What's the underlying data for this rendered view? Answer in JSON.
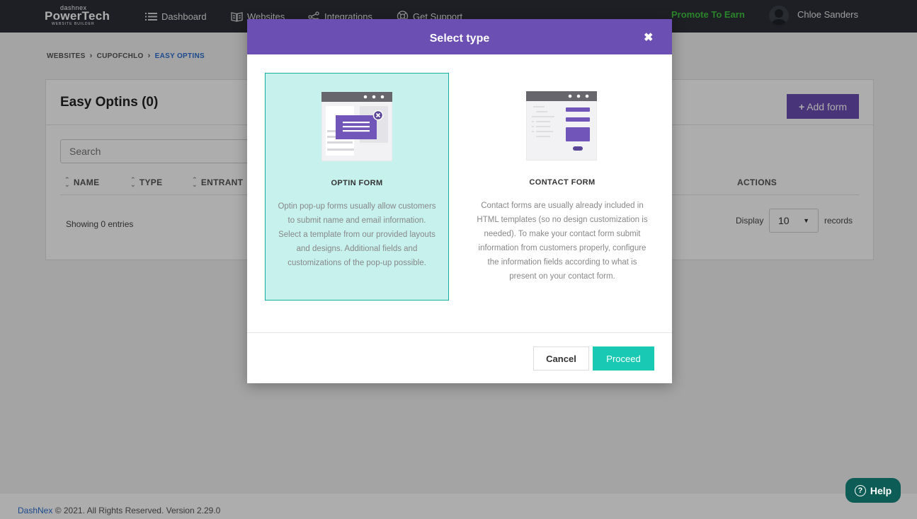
{
  "topbar": {
    "logo": {
      "line1": "dashnex",
      "line2": "PowerTech",
      "line3": "WEBSITE BUILDER"
    },
    "nav": [
      {
        "label": "Dashboard",
        "icon": "list-icon"
      },
      {
        "label": "Websites",
        "icon": "book-icon"
      },
      {
        "label": "Integrations",
        "icon": "share-icon"
      },
      {
        "label": "Get Support",
        "icon": "lifebuoy-icon"
      }
    ],
    "promote_label": "Promote To Earn",
    "user_name": "Chloe Sanders"
  },
  "breadcrumb": [
    "WEBSITES",
    "CUPOFCHLO",
    "EASY OPTINS"
  ],
  "card": {
    "title": "Easy Optins (0)",
    "add_label": "Add form",
    "search_placeholder": "Search",
    "columns": [
      "NAME",
      "TYPE",
      "ENTRANT",
      "ACTIONS"
    ],
    "showing": "Showing 0 entries",
    "display_label": "Display",
    "records_value": "10",
    "records_label": "records"
  },
  "footer": {
    "brand": "DashNex",
    "text": " © 2021. All Rights Reserved. Version 2.29.0"
  },
  "help_label": "Help",
  "modal": {
    "title": "Select type",
    "options": [
      {
        "title": "OPTIN FORM",
        "description": "Optin pop-up forms usually allow customers to submit name and email information. Select a template from our provided layouts and designs. Additional fields and customizations of the pop-up possible."
      },
      {
        "title": "CONTACT FORM",
        "description": "Contact forms are usually already included in HTML templates (so no design customization is needed). To make your contact form submit information from customers properly, configure the information fields according to what is present on your contact form."
      }
    ],
    "cancel_label": "Cancel",
    "proceed_label": "Proceed"
  },
  "colors": {
    "accent_purple": "#6b4fb3",
    "proceed_teal": "#19c9b4",
    "selected_bg": "#c7f1ed",
    "promote_green": "#3ec33e",
    "help_bg": "#0e5c56"
  }
}
